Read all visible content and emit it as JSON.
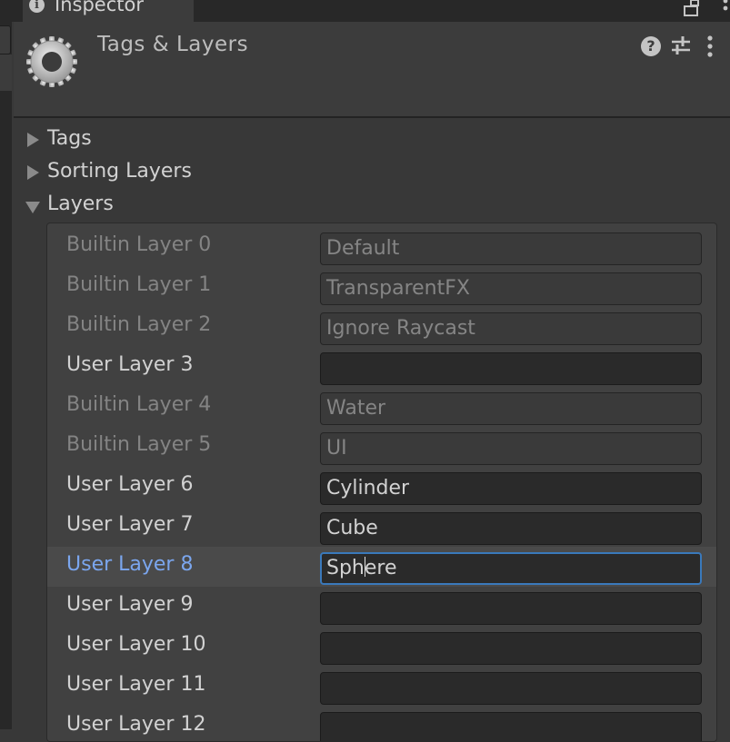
{
  "window": {
    "tab_title": "Inspector"
  },
  "header": {
    "title": "Tags & Layers",
    "help_glyph": "?"
  },
  "icons": {
    "tab": "info-icon",
    "header": "gear-icon",
    "help": "help-icon",
    "presets": "presets-sliders-icon",
    "menu": "kebab-menu-icon",
    "maximize": "maximize-icon"
  },
  "foldouts": [
    {
      "label": "Tags",
      "expanded": false
    },
    {
      "label": "Sorting Layers",
      "expanded": false
    },
    {
      "label": "Layers",
      "expanded": true
    }
  ],
  "layers": [
    {
      "label": "Builtin Layer 0",
      "value": "Default",
      "editable": false
    },
    {
      "label": "Builtin Layer 1",
      "value": "TransparentFX",
      "editable": false
    },
    {
      "label": "Builtin Layer 2",
      "value": "Ignore Raycast",
      "editable": false
    },
    {
      "label": "User Layer 3",
      "value": "",
      "editable": true
    },
    {
      "label": "Builtin Layer 4",
      "value": "Water",
      "editable": false
    },
    {
      "label": "Builtin Layer 5",
      "value": "UI",
      "editable": false
    },
    {
      "label": "User Layer 6",
      "value": "Cylinder",
      "editable": true
    },
    {
      "label": "User Layer 7",
      "value": "Cube",
      "editable": true
    },
    {
      "label": "User Layer 8",
      "value": "Sphere",
      "editable": true,
      "selected": true,
      "caret_after": "Sph",
      "caret_rest": "ere"
    },
    {
      "label": "User Layer 9",
      "value": "",
      "editable": true
    },
    {
      "label": "User Layer 10",
      "value": "",
      "editable": true
    },
    {
      "label": "User Layer 11",
      "value": "",
      "editable": true
    },
    {
      "label": "User Layer 12",
      "value": "",
      "editable": true
    }
  ],
  "colors": {
    "background": "#383838",
    "selected_label": "#7ba6ee",
    "focus_border": "#3a79bb"
  }
}
